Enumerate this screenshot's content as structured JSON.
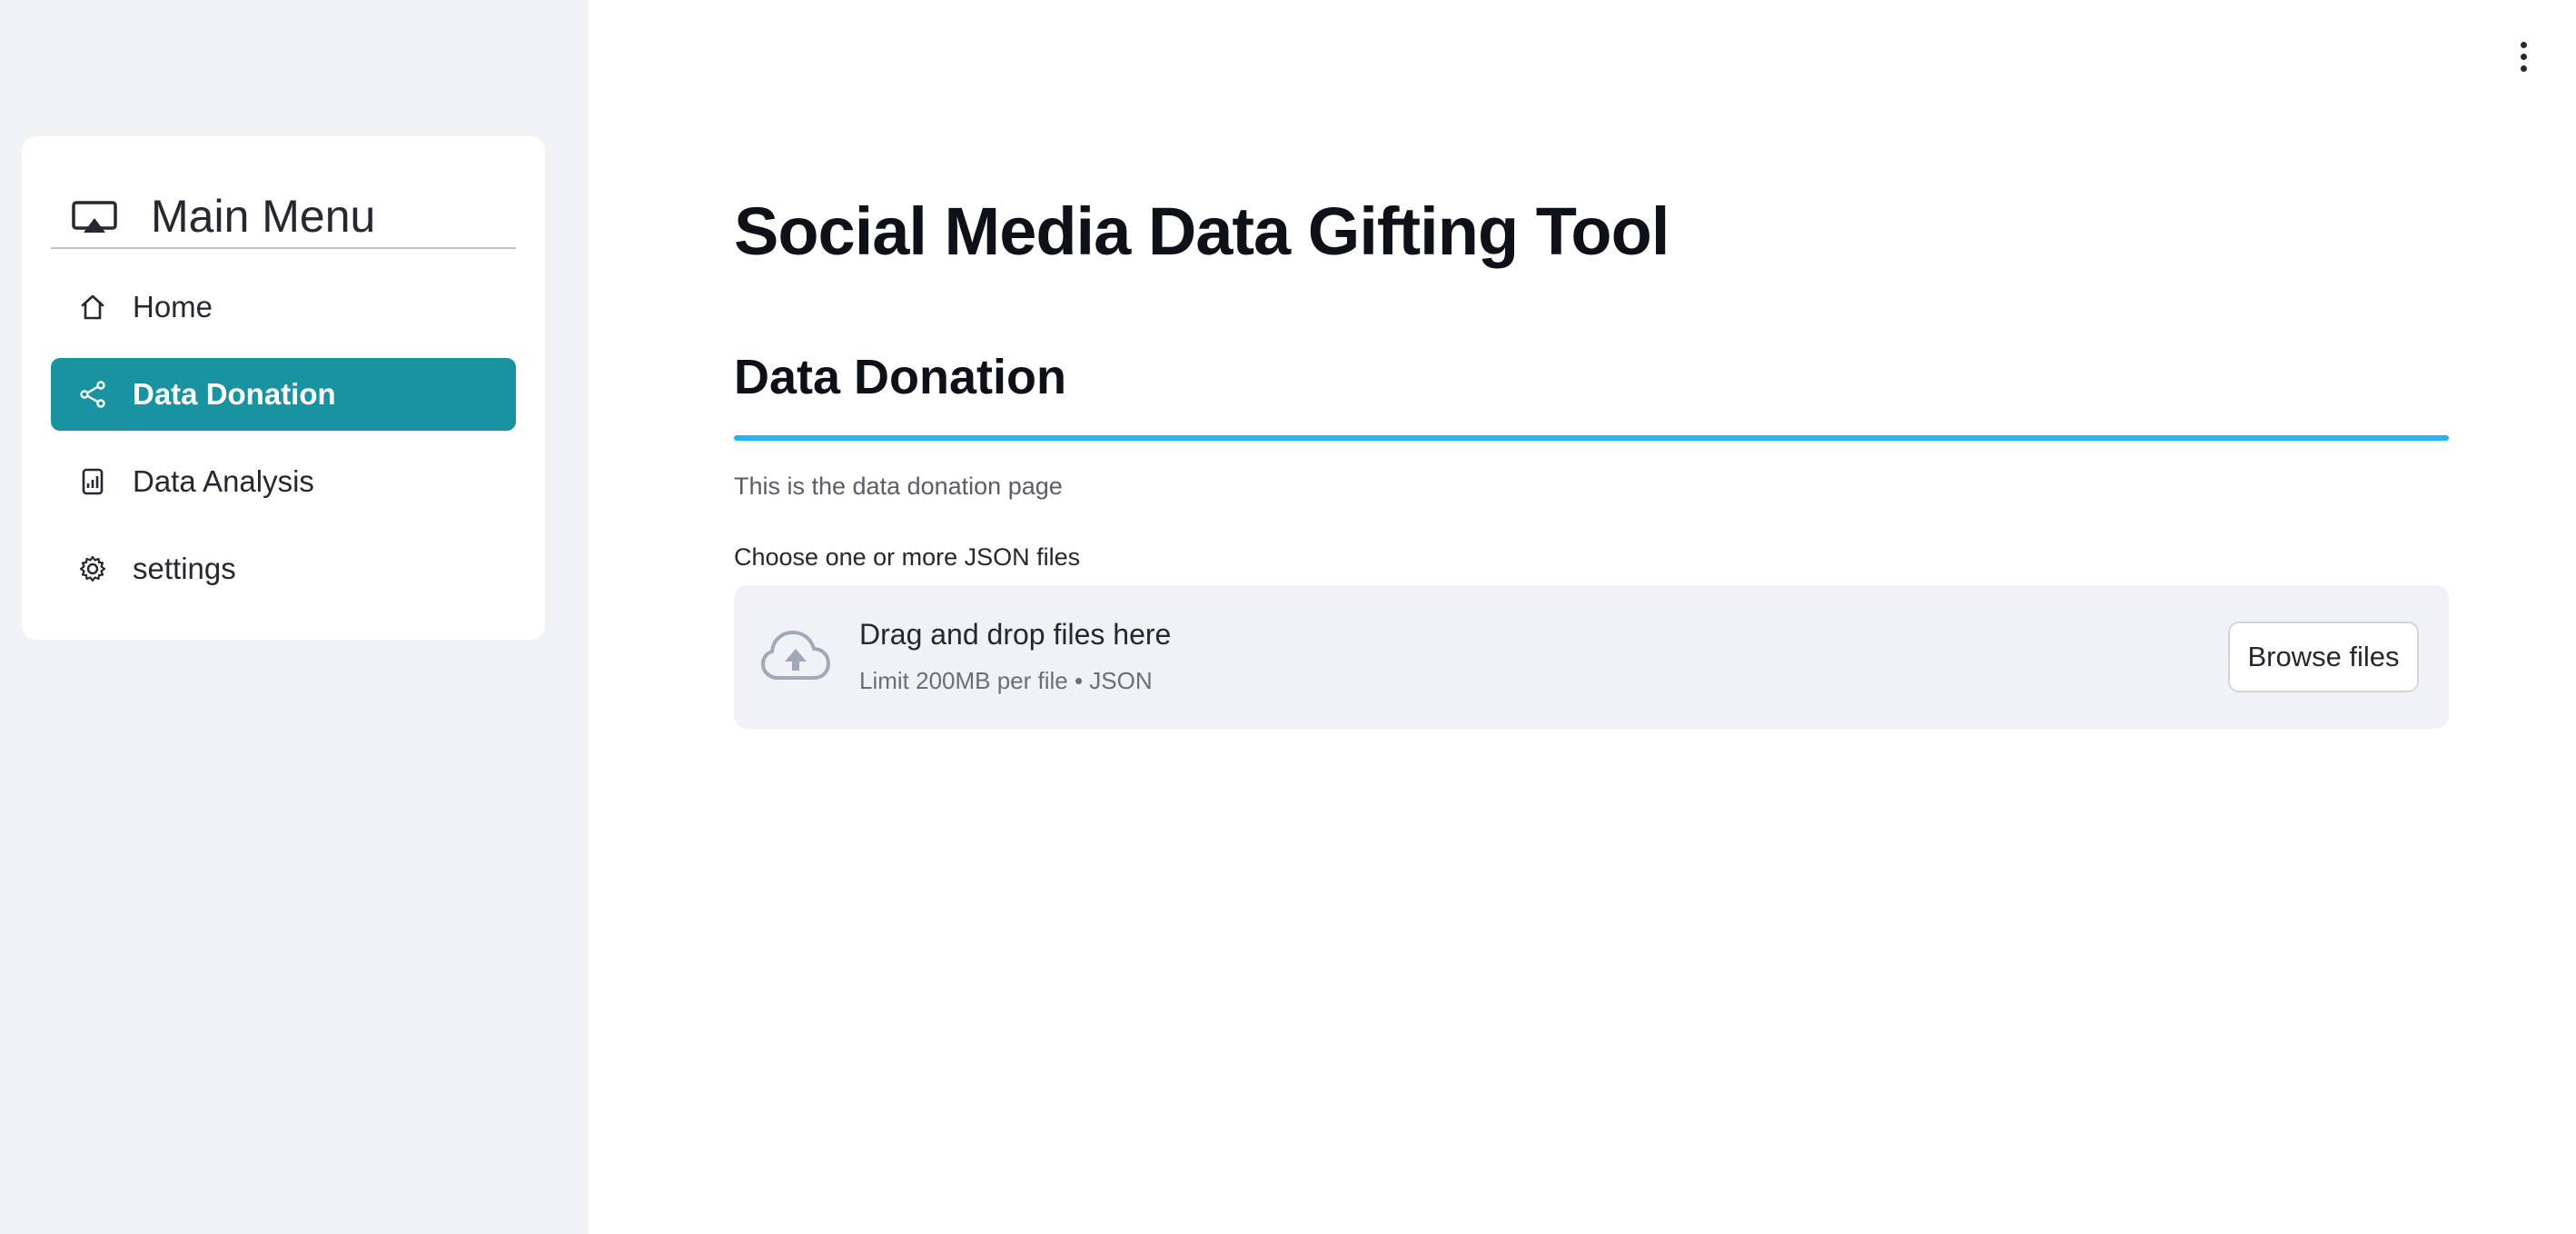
{
  "sidebar": {
    "menu_title": "Main Menu",
    "menu_icon": "cast-icon",
    "items": [
      {
        "label": "Home",
        "icon": "house-icon",
        "active": false
      },
      {
        "label": "Data Donation",
        "icon": "share-icon",
        "active": true
      },
      {
        "label": "Data Analysis",
        "icon": "bar-chart-file-icon",
        "active": false
      },
      {
        "label": "settings",
        "icon": "gear-icon",
        "active": false
      }
    ],
    "active_color": "#1a93a0"
  },
  "main": {
    "title": "Social Media Data Gifting Tool",
    "section_title": "Data Donation",
    "divider_color": "#29b5e8",
    "caption": "This is the data donation page",
    "uploader": {
      "label": "Choose one or more JSON files",
      "drop_text": "Drag and drop files here",
      "limit_text": "Limit 200MB per file • JSON",
      "browse_label": "Browse files",
      "icon": "cloud-upload-icon"
    }
  },
  "toolbar": {
    "menu_icon": "kebab-menu-icon"
  }
}
